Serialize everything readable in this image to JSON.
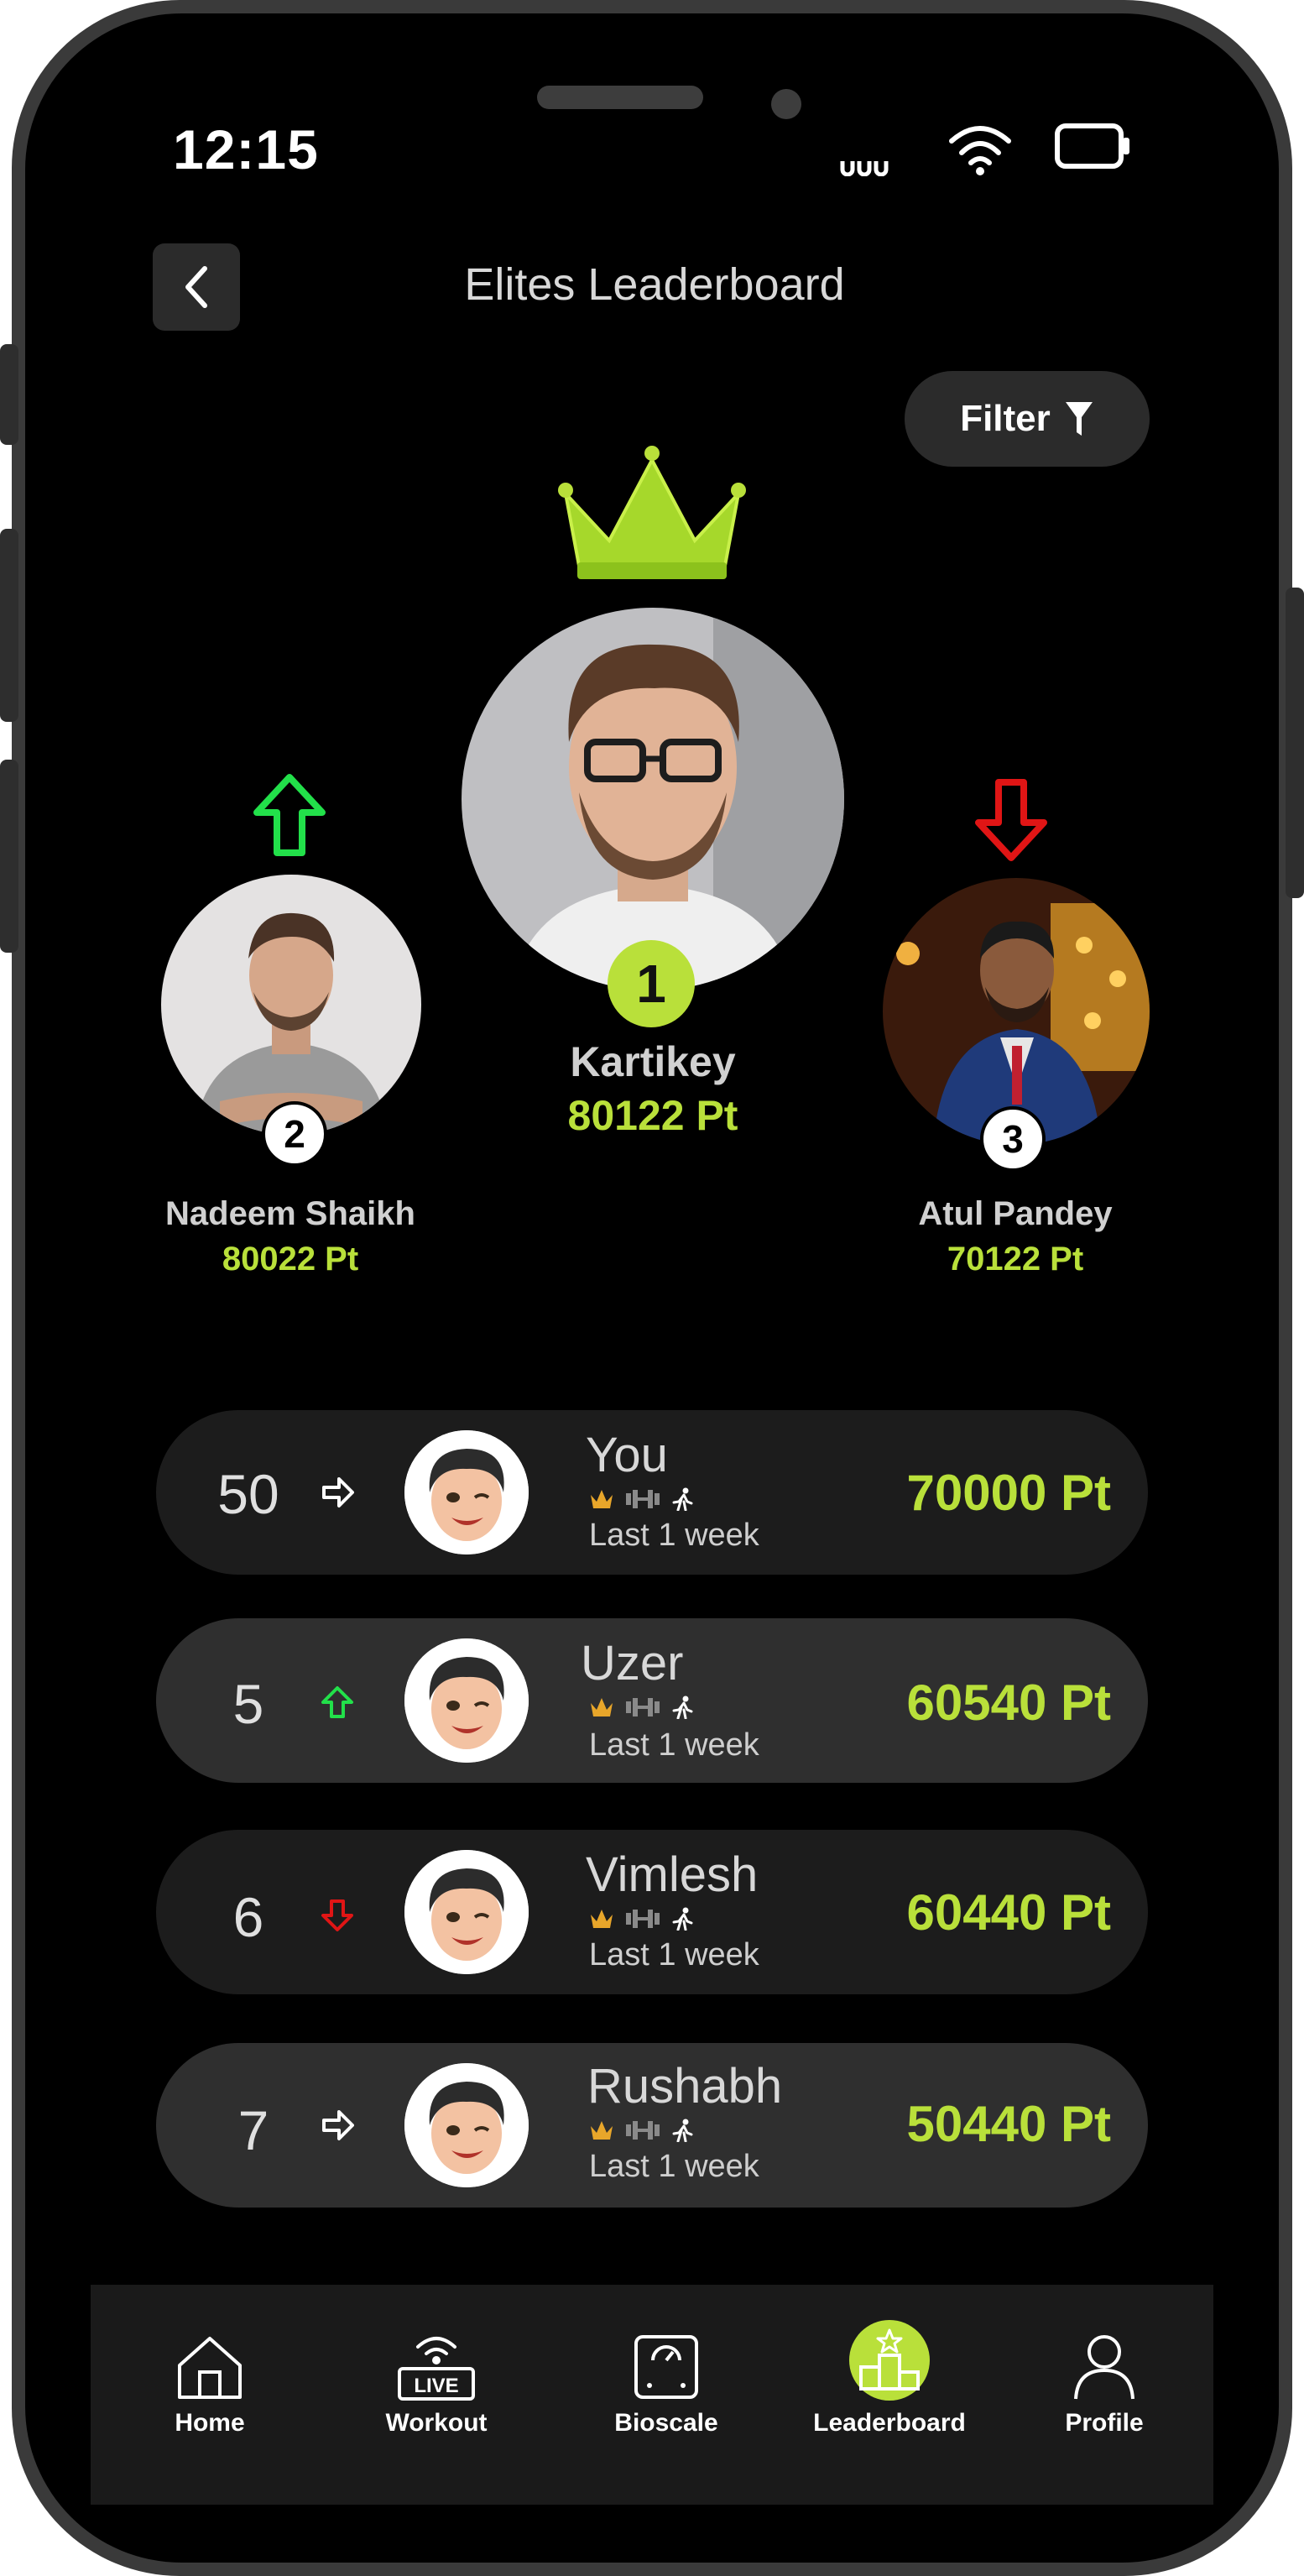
{
  "status_bar": {
    "time": "12:15"
  },
  "header": {
    "title": "Elites Leaderboard"
  },
  "filter": {
    "label": "Filter"
  },
  "colors": {
    "accent": "#b9e03a",
    "up": "#22e04a",
    "down": "#e01515"
  },
  "podium": {
    "first": {
      "rank": "1",
      "name": "Kartikey",
      "points": "80122 Pt"
    },
    "second": {
      "rank": "2",
      "name": "Nadeem Shaikh",
      "points": "80022 Pt",
      "trend": "up"
    },
    "third": {
      "rank": "3",
      "name": "Atul Pandey",
      "points": "70122 Pt",
      "trend": "down"
    }
  },
  "rows": [
    {
      "rank": "50",
      "trend": "same",
      "name": "You",
      "period": "Last 1 week",
      "points": "70000 Pt"
    },
    {
      "rank": "5",
      "trend": "up",
      "name": "Uzer",
      "period": "Last 1 week",
      "points": "60540 Pt"
    },
    {
      "rank": "6",
      "trend": "down",
      "name": "Vimlesh",
      "period": "Last 1 week",
      "points": "60440 Pt"
    },
    {
      "rank": "7",
      "trend": "same",
      "name": "Rushabh",
      "period": "Last 1 week",
      "points": "50440 Pt"
    }
  ],
  "nav": {
    "items": [
      {
        "label": "Home",
        "icon": "home-icon"
      },
      {
        "label": "Workout",
        "icon": "live-workout-icon",
        "badge": "LIVE"
      },
      {
        "label": "Bioscale",
        "icon": "scale-icon"
      },
      {
        "label": "Leaderboard",
        "icon": "leaderboard-icon",
        "active": true
      },
      {
        "label": "Profile",
        "icon": "profile-icon"
      }
    ]
  }
}
